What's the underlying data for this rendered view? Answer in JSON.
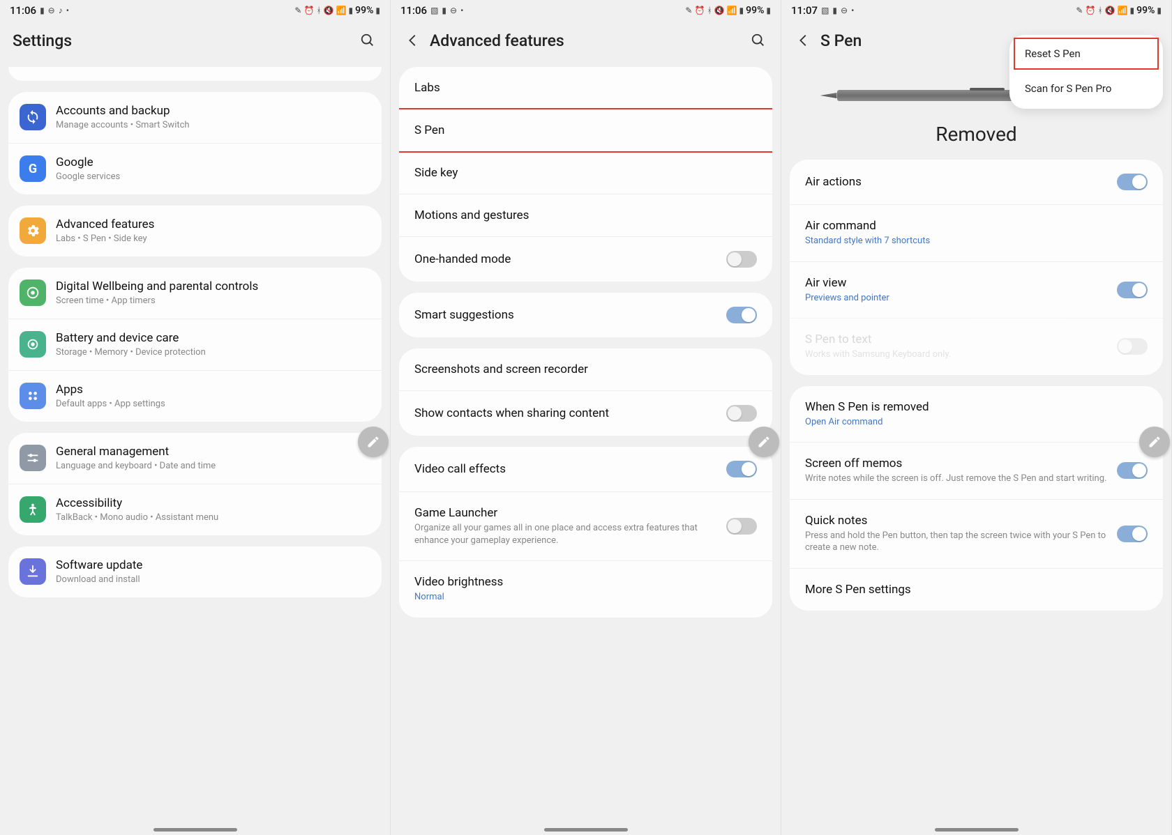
{
  "status": {
    "time1": "11:06",
    "time2": "11:06",
    "time3": "11:07",
    "battery": "99%"
  },
  "screen1": {
    "title": "Settings",
    "rows": {
      "accounts": {
        "title": "Accounts and backup",
        "sub": "Manage accounts  •  Smart Switch"
      },
      "google": {
        "title": "Google",
        "sub": "Google services"
      },
      "advanced": {
        "title": "Advanced features",
        "sub": "Labs  •  S Pen  •  Side key"
      },
      "wellbeing": {
        "title": "Digital Wellbeing and parental controls",
        "sub": "Screen time  •  App timers"
      },
      "battery": {
        "title": "Battery and device care",
        "sub": "Storage  •  Memory  •  Device protection"
      },
      "apps": {
        "title": "Apps",
        "sub": "Default apps  •  App settings"
      },
      "general": {
        "title": "General management",
        "sub": "Language and keyboard  •  Date and time"
      },
      "access": {
        "title": "Accessibility",
        "sub": "TalkBack  •  Mono audio  •  Assistant menu"
      },
      "software": {
        "title": "Software update",
        "sub": "Download and install"
      }
    }
  },
  "screen2": {
    "title": "Advanced features",
    "rows": {
      "labs": "Labs",
      "spen": "S Pen",
      "sidekey": "Side key",
      "motions": "Motions and gestures",
      "onehanded": "One-handed mode",
      "smartsug": "Smart suggestions",
      "screenshots": "Screenshots and screen recorder",
      "showcontacts": "Show contacts when sharing content",
      "videocall": "Video call effects",
      "gamelauncher": {
        "title": "Game Launcher",
        "sub": "Organize all your games all in one place and access extra features that enhance your gameplay experience."
      },
      "videobright": {
        "title": "Video brightness",
        "sub": "Normal"
      }
    }
  },
  "screen3": {
    "title": "S Pen",
    "status": "Removed",
    "menu": {
      "reset": "Reset S Pen",
      "scan": "Scan for S Pen Pro"
    },
    "rows": {
      "airactions": "Air actions",
      "aircommand": {
        "title": "Air command",
        "sub": "Standard style with 7 shortcuts"
      },
      "airview": {
        "title": "Air view",
        "sub": "Previews and pointer"
      },
      "spentext": {
        "title": "S Pen to text",
        "sub": "Works with Samsung Keyboard only."
      },
      "whenremoved": {
        "title": "When S Pen is removed",
        "sub": "Open Air command"
      },
      "screenoff": {
        "title": "Screen off memos",
        "sub": "Write notes while the screen is off. Just remove the S Pen and start writing."
      },
      "quicknotes": {
        "title": "Quick notes",
        "sub": "Press and hold the Pen button, then tap the screen twice with your S Pen to create a new note."
      },
      "more": "More S Pen settings"
    }
  }
}
